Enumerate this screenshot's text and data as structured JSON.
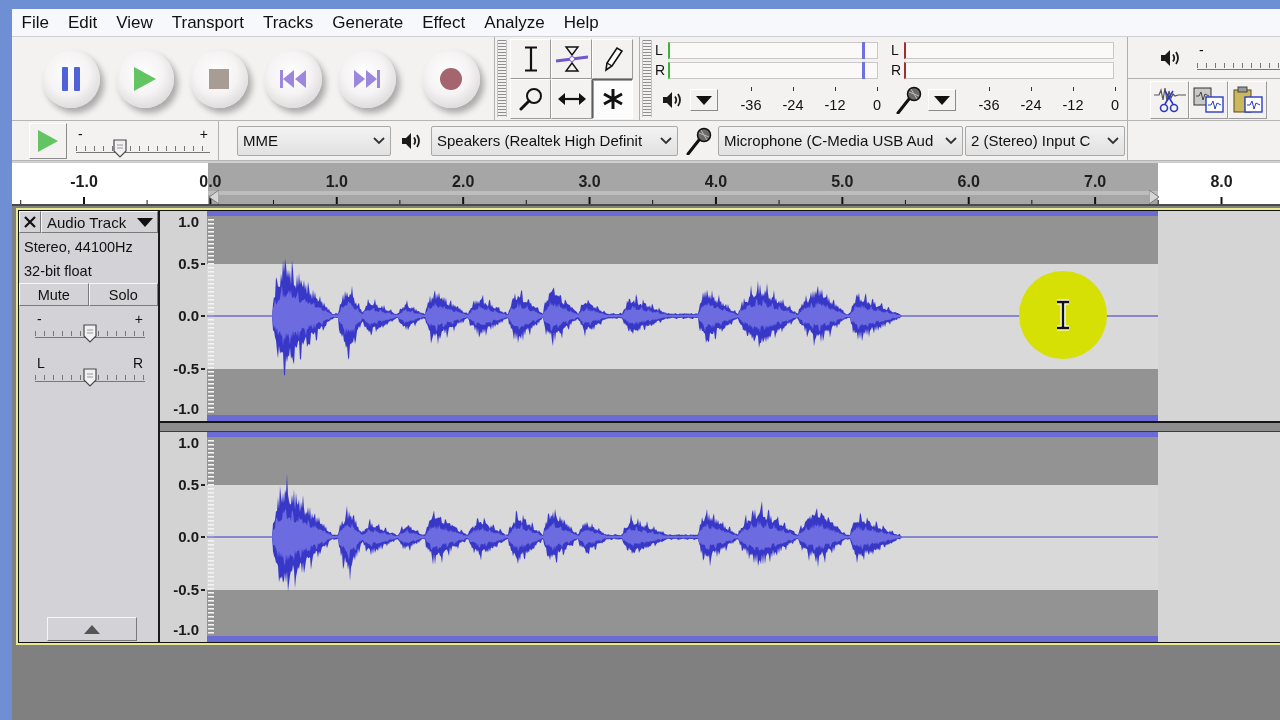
{
  "menu_bar": {
    "items": [
      "File",
      "Edit",
      "View",
      "Transport",
      "Tracks",
      "Generate",
      "Effect",
      "Analyze",
      "Help"
    ]
  },
  "transport_toolbar": {
    "buttons": [
      {
        "kind": "pause"
      },
      {
        "kind": "play"
      },
      {
        "kind": "stop"
      },
      {
        "kind": "skip-start"
      },
      {
        "kind": "skip-end"
      },
      {
        "kind": "record"
      }
    ]
  },
  "tools_toolbar": {
    "tools": [
      {
        "kind": "selection",
        "selected": false
      },
      {
        "kind": "envelope",
        "selected": false
      },
      {
        "kind": "draw",
        "selected": false
      },
      {
        "kind": "zoom",
        "selected": false
      },
      {
        "kind": "time-shift",
        "selected": false
      },
      {
        "kind": "multi",
        "selected": true
      }
    ]
  },
  "meter_toolbar": {
    "playback": {
      "channels": [
        {
          "label": "L",
          "level": 0.93
        },
        {
          "label": "R",
          "level": 0.93
        }
      ],
      "ticks": [
        "-36",
        "-24",
        "-12",
        "0"
      ]
    },
    "recording": {
      "channels": [
        {
          "label": "L"
        },
        {
          "label": "R"
        }
      ],
      "ticks": [
        "-36",
        "-24",
        "-12",
        "0"
      ]
    }
  },
  "mixer_toolbar": {
    "output_slider": {
      "min_label": "-"
    }
  },
  "edit_toolbar": {
    "buttons": [
      {
        "kind": "cut"
      },
      {
        "kind": "copy"
      },
      {
        "kind": "paste"
      }
    ]
  },
  "play_at_speed_toolbar": {
    "slider": {
      "min_label": "-",
      "max_label": "+",
      "level": 0.33
    }
  },
  "device_toolbar": {
    "host": "MME",
    "output_device": "Speakers (Realtek High Definit",
    "input_device": "Microphone (C-Media USB Aud",
    "input_channels": "2 (Stereo) Input C"
  },
  "timeline": {
    "labels": [
      "-1.0",
      "0.0",
      "1.0",
      "2.0",
      "3.0",
      "4.0",
      "5.0",
      "6.0",
      "7.0",
      "8.0"
    ]
  },
  "track": {
    "focused": true,
    "name": "Audio Track",
    "info": [
      "Stereo, 44100Hz",
      "32-bit float"
    ],
    "buttons": [
      {
        "label": "Mute",
        "on": false
      },
      {
        "label": "Solo",
        "on": false
      }
    ],
    "gain": {
      "min_label": "-",
      "max_label": "+",
      "level": 0.5
    },
    "pan": {
      "min_label": "L",
      "max_label": "R",
      "level": 0.5
    },
    "channels": [
      {
        "scale": [
          "1.0",
          "0.5",
          "0.0",
          "-0.5",
          "-1.0"
        ]
      },
      {
        "scale": [
          "1.0",
          "0.5",
          "0.0",
          "-0.5",
          "-1.0"
        ]
      }
    ]
  }
}
